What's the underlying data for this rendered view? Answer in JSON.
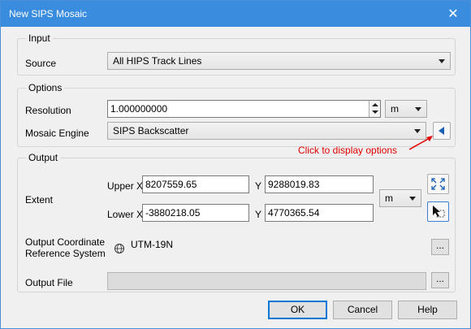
{
  "window": {
    "title": "New SIPS Mosaic",
    "close_glyph": "✕"
  },
  "input": {
    "group_title": "Input",
    "source_label": "Source",
    "source_value": "All HIPS Track Lines"
  },
  "options": {
    "group_title": "Options",
    "resolution_label": "Resolution",
    "resolution_value": "1.000000000",
    "resolution_unit": "m",
    "engine_label": "Mosaic Engine",
    "engine_value": "SIPS Backscatter",
    "annotation": "Click to display options"
  },
  "output": {
    "group_title": "Output",
    "extent_label": "Extent",
    "upper_x_label": "Upper X",
    "upper_x_value": "8207559.65",
    "upper_y_label": "Y",
    "upper_y_value": "9288019.83",
    "lower_x_label": "Lower X",
    "lower_x_value": "-3880218.05",
    "lower_y_label": "Y",
    "lower_y_value": "4770365.54",
    "extent_unit": "m",
    "crs_label_line1": "Output Coordinate",
    "crs_label_line2": "Reference System",
    "crs_value": "UTM-19N",
    "browse_glyph": "...",
    "file_label": "Output File",
    "file_value": ""
  },
  "buttons": {
    "ok": "OK",
    "cancel": "Cancel",
    "help": "Help"
  },
  "colors": {
    "titlebar": "#3a8dde",
    "annotation": "#e00000",
    "accent": "#0078d7"
  }
}
